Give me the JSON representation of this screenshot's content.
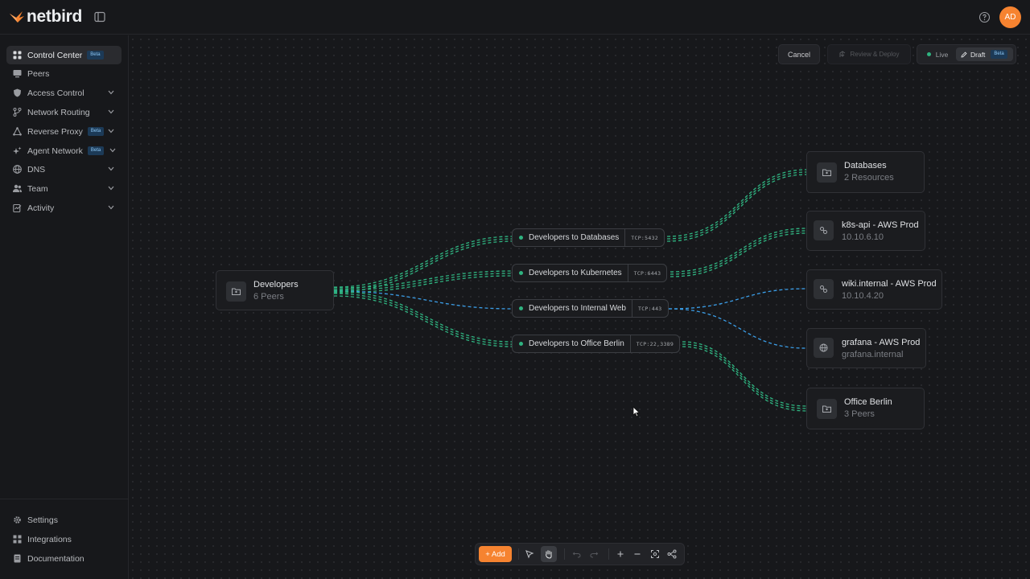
{
  "app": {
    "brand": "netbird",
    "avatar_initials": "AD",
    "accent_color": "#f68330"
  },
  "sidebar": {
    "items": [
      {
        "label": "Control Center",
        "badge": "Beta",
        "icon": "grid-icon",
        "active": true
      },
      {
        "label": "Peers",
        "icon": "monitor-icon"
      },
      {
        "label": "Access Control",
        "icon": "shield-icon",
        "expandable": true
      },
      {
        "label": "Network Routing",
        "icon": "branch-icon",
        "expandable": true
      },
      {
        "label": "Reverse Proxy",
        "badge": "Beta",
        "icon": "triangle-nodes-icon",
        "expandable": true
      },
      {
        "label": "Agent Network",
        "badge": "Beta",
        "icon": "sparkle-icon",
        "expandable": true
      },
      {
        "label": "DNS",
        "icon": "globe-icon",
        "expandable": true
      },
      {
        "label": "Team",
        "icon": "users-icon",
        "expandable": true
      },
      {
        "label": "Activity",
        "icon": "activity-icon",
        "expandable": true
      }
    ],
    "footer": [
      {
        "label": "Settings",
        "icon": "gear-icon"
      },
      {
        "label": "Integrations",
        "icon": "integrations-icon"
      },
      {
        "label": "Documentation",
        "icon": "document-icon"
      }
    ]
  },
  "header": {
    "cancel_label": "Cancel",
    "review_label": "Review & Deploy",
    "mode_live": "Live",
    "mode_draft": "Draft",
    "mode_draft_badge": "Beta"
  },
  "graph": {
    "source": {
      "title": "Developers",
      "subtitle": "6 Peers",
      "icon": "group-icon"
    },
    "policies": [
      {
        "name": "Developers to Databases",
        "port": "TCP:5432"
      },
      {
        "name": "Developers to Kubernetes",
        "port": "TCP:6443"
      },
      {
        "name": "Developers to Internal Web",
        "port": "TCP:443"
      },
      {
        "name": "Developers to Office Berlin",
        "port": "TCP:22,3389"
      }
    ],
    "destinations": [
      {
        "title": "Databases",
        "subtitle": "2 Resources",
        "icon": "group-icon"
      },
      {
        "title": "k8s-api  -  AWS Prod",
        "subtitle": "10.10.6.10",
        "icon": "network-resource-icon"
      },
      {
        "title": "wiki.internal  -  AWS Prod",
        "subtitle": "10.10.4.20",
        "icon": "network-resource-icon"
      },
      {
        "title": "grafana  -  AWS Prod",
        "subtitle": "grafana.internal",
        "icon": "globe-icon"
      },
      {
        "title": "Office Berlin",
        "subtitle": "3 Peers",
        "icon": "group-icon"
      }
    ],
    "edge_colors": {
      "allowed": "#2fb380",
      "web": "#3b9ee8"
    }
  },
  "toolbar": {
    "add_label": "+ Add"
  }
}
